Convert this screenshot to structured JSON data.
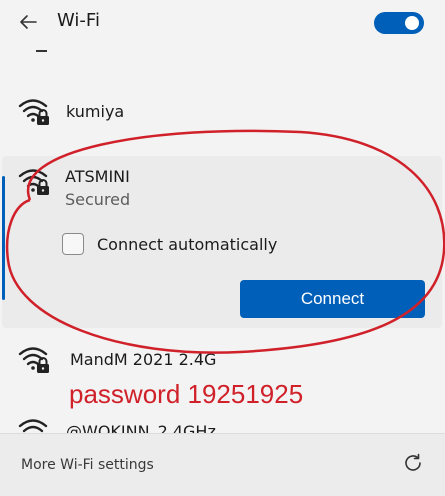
{
  "header": {
    "title": "Wi-Fi",
    "wifi_enabled": true
  },
  "networks": [
    {
      "name": "kumiya",
      "secured": true
    },
    {
      "name": "ATSMINI",
      "secured": true,
      "status": "Secured",
      "connect_automatically_label": "Connect automatically",
      "connect_automatically": false,
      "connect_label": "Connect",
      "selected": true
    },
    {
      "name": "MandM 2021 2.4G",
      "secured": true
    },
    {
      "name": "@WOKINN_2.4GHz",
      "secured": true
    }
  ],
  "annotation": {
    "text": "password 19251925",
    "color": "#d0212a"
  },
  "footer": {
    "settings_label": "More Wi-Fi settings"
  },
  "colors": {
    "accent": "#005fb8",
    "annotation": "#d0212a"
  }
}
